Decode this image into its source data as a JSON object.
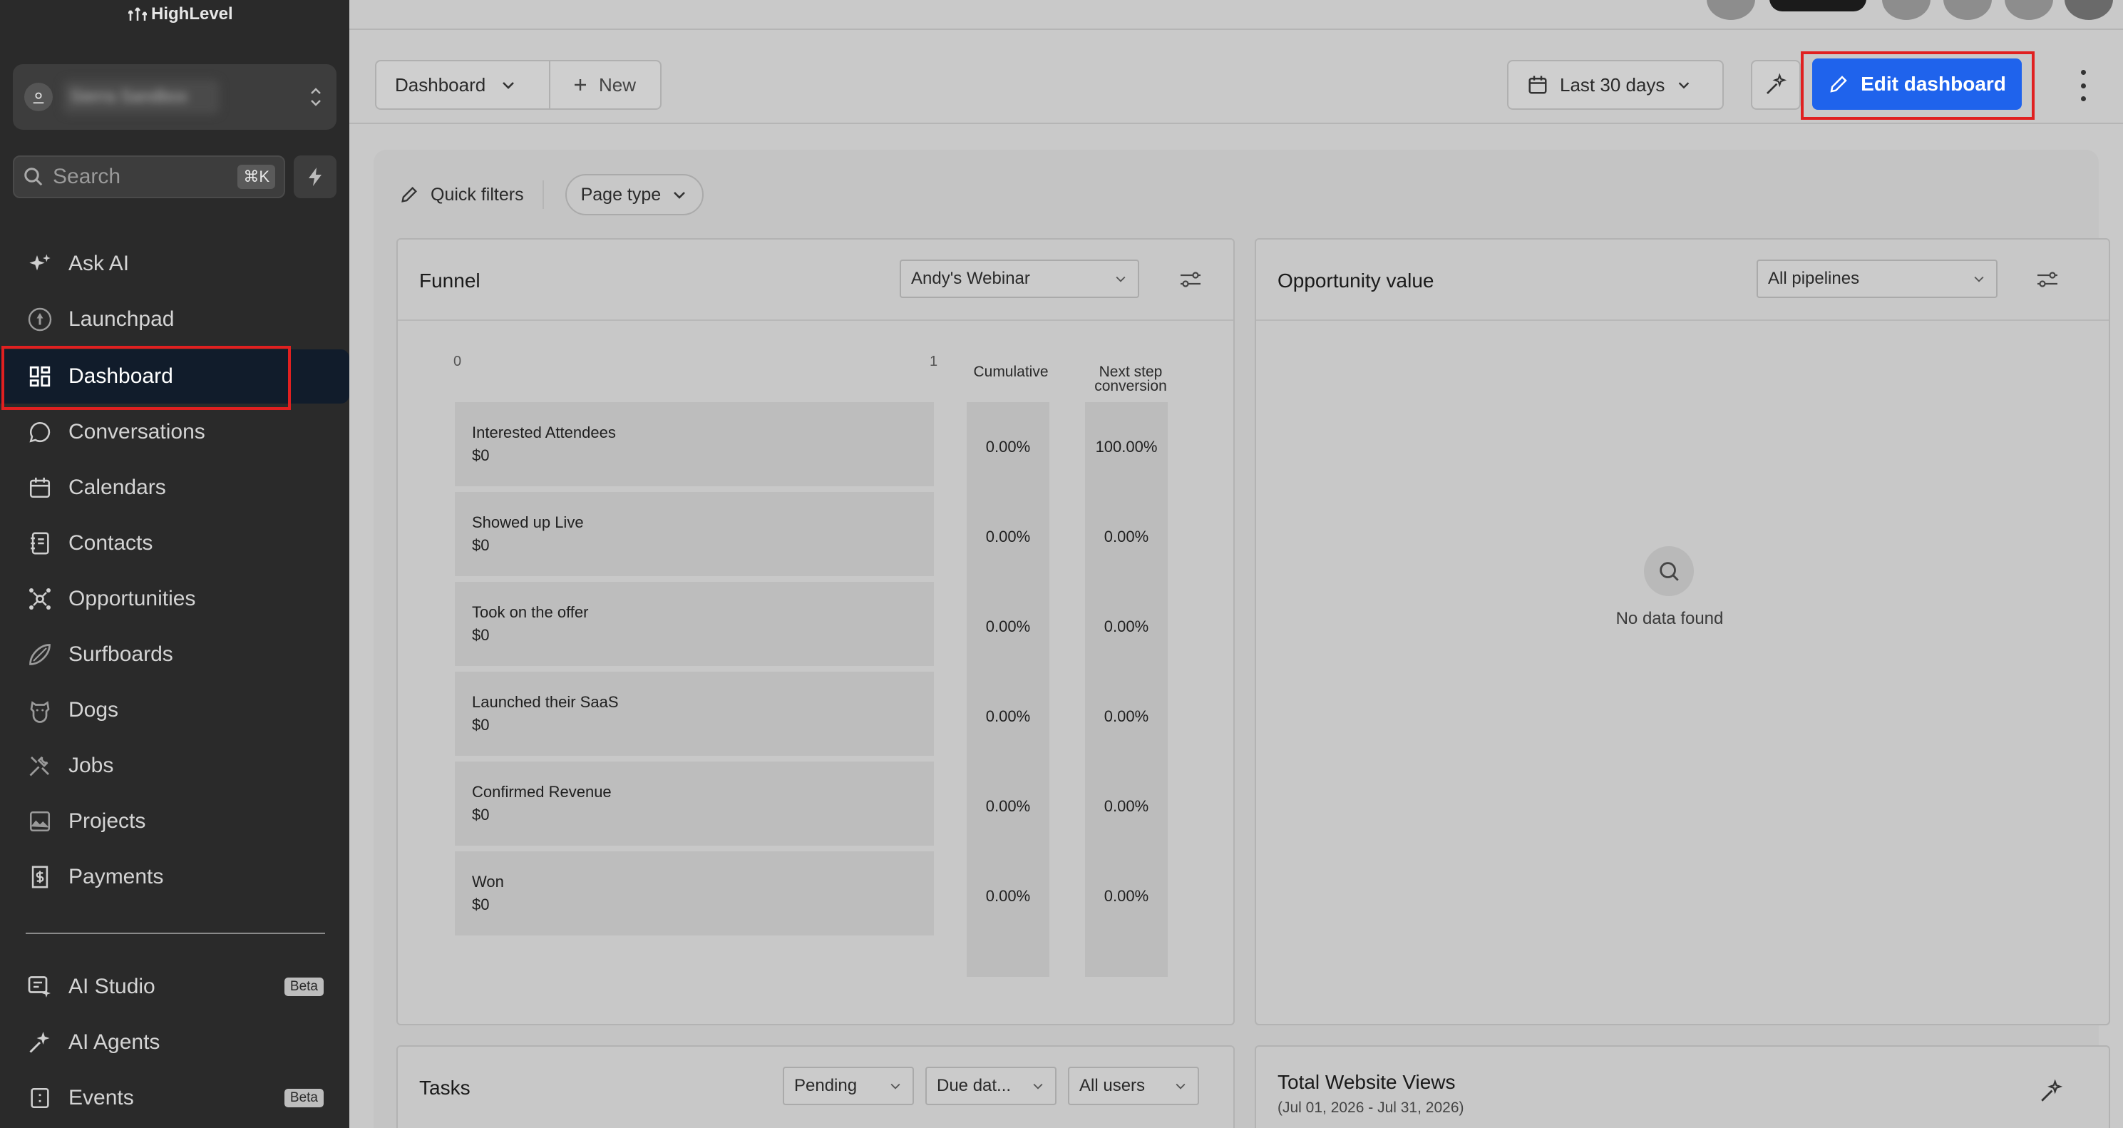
{
  "app": {
    "logo_text": "HighLevel"
  },
  "sidebar": {
    "account_name": "Sierra Sandbox",
    "search_label": "Search",
    "search_shortcut": "⌘K",
    "items": [
      {
        "label": "Ask AI",
        "icon": "sparkle-icon"
      },
      {
        "label": "Launchpad",
        "icon": "rocket-icon"
      },
      {
        "label": "Dashboard",
        "icon": "grid-icon",
        "active": true
      },
      {
        "label": "Conversations",
        "icon": "chat-bubble-icon"
      },
      {
        "label": "Calendars",
        "icon": "calendar-icon"
      },
      {
        "label": "Contacts",
        "icon": "address-book-icon"
      },
      {
        "label": "Opportunities",
        "icon": "network-icon"
      },
      {
        "label": "Surfboards",
        "icon": "surfboard-icon"
      },
      {
        "label": "Dogs",
        "icon": "dog-icon"
      },
      {
        "label": "Jobs",
        "icon": "tools-icon"
      },
      {
        "label": "Projects",
        "icon": "chart-image-icon"
      },
      {
        "label": "Payments",
        "icon": "receipt-icon"
      }
    ],
    "bottom_items": [
      {
        "label": "AI Studio",
        "icon": "ai-studio-icon",
        "badge": "Beta"
      },
      {
        "label": "AI Agents",
        "icon": "ai-agents-icon"
      },
      {
        "label": "Events",
        "icon": "events-icon",
        "badge": "Beta"
      }
    ]
  },
  "header": {
    "dashboard_select": "Dashboard",
    "new_label": "New",
    "date_range": "Last 30 days",
    "edit_label": "Edit dashboard"
  },
  "filters": {
    "quick_label": "Quick filters",
    "page_type_label": "Page type"
  },
  "funnel": {
    "title": "Funnel",
    "select": "Andy's Webinar",
    "axis_min": "0",
    "axis_max": "1",
    "col_cumulative": "Cumulative",
    "col_next_1": "Next step",
    "col_next_2": "conversion",
    "stages": [
      {
        "name": "Interested Attendees",
        "value": "$0",
        "cumulative": "0.00%",
        "next": "100.00%"
      },
      {
        "name": "Showed up Live",
        "value": "$0",
        "cumulative": "0.00%",
        "next": "0.00%"
      },
      {
        "name": "Took on the offer",
        "value": "$0",
        "cumulative": "0.00%",
        "next": "0.00%"
      },
      {
        "name": "Launched their SaaS",
        "value": "$0",
        "cumulative": "0.00%",
        "next": "0.00%"
      },
      {
        "name": "Confirmed Revenue",
        "value": "$0",
        "cumulative": "0.00%",
        "next": "0.00%"
      },
      {
        "name": "Won",
        "value": "$0",
        "cumulative": "0.00%",
        "next": "0.00%"
      }
    ]
  },
  "opportunity": {
    "title": "Opportunity value",
    "select": "All pipelines",
    "empty_text": "No data found"
  },
  "tasks": {
    "title": "Tasks",
    "status_select": "Pending",
    "due_select": "Due dat...",
    "users_select": "All users"
  },
  "views": {
    "title": "Total Website Views",
    "subtitle": "(Jul 01, 2026 - Jul 31, 2026)"
  }
}
